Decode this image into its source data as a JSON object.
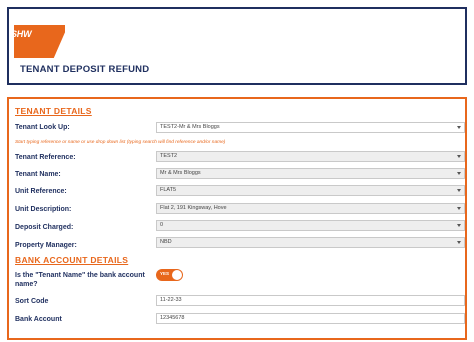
{
  "header": {
    "logo_text": "SHW",
    "title": "TENANT DEPOSIT REFUND"
  },
  "colors": {
    "brand_orange": "#e8671c",
    "navy": "#1f2f5f"
  },
  "tenant_details": {
    "section_title": "TENANT DETAILS",
    "lookup_label": "Tenant Look Up:",
    "lookup_value": "TEST2-Mr & Mrs Bloggs",
    "hint": "Start typing reference or name or use drop down list (typing search will find reference and/or name)",
    "reference_label": "Tenant Reference:",
    "reference_value": "TEST2",
    "name_label": "Tenant Name:",
    "name_value": "Mr & Mrs Bloggs",
    "unit_ref_label": "Unit Reference:",
    "unit_ref_value": "FLAT5",
    "unit_desc_label": "Unit Description:",
    "unit_desc_value": "Flat 2, 191 Kingsway, Hove",
    "deposit_label": "Deposit Charged:",
    "deposit_value": "0",
    "manager_label": "Property Manager:",
    "manager_value": "NBD"
  },
  "bank_details": {
    "section_title": "BANK ACCOUNT DETAILS",
    "is_tenant_name_label_line1": "Is the \"Tenant Name\" the bank account",
    "is_tenant_name_label_line2": "name?",
    "toggle_value": "YES",
    "sort_code_label": "Sort Code",
    "sort_code_value": "11-22-33",
    "account_label": "Bank Account",
    "account_value": "12345678"
  }
}
